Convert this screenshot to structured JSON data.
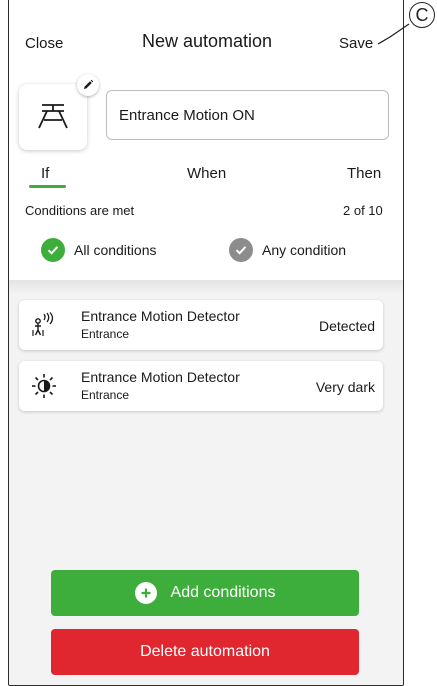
{
  "header": {
    "close_label": "Close",
    "title": "New automation",
    "save_label": "Save"
  },
  "callout": {
    "letter": "C"
  },
  "automation": {
    "icon": "motion-sensor-icon",
    "name": "Entrance Motion ON"
  },
  "tabs": [
    {
      "label": "If",
      "active": true
    },
    {
      "label": "When",
      "active": false
    },
    {
      "label": "Then",
      "active": false
    }
  ],
  "conditions": {
    "label": "Conditions are met",
    "count": "2 of 10",
    "options": [
      {
        "label": "All conditions",
        "selected": true,
        "color": "#3dae3b"
      },
      {
        "label": "Any condition",
        "selected": false,
        "color": "#8c8c8c"
      }
    ],
    "items": [
      {
        "icon": "motion-detector-icon",
        "title": "Entrance Motion Detector",
        "subtitle": "Entrance",
        "value": "Detected"
      },
      {
        "icon": "brightness-icon",
        "title": "Entrance Motion Detector",
        "subtitle": "Entrance",
        "value": "Very dark"
      }
    ]
  },
  "actions": {
    "add_label": "Add conditions",
    "delete_label": "Delete automation"
  },
  "colors": {
    "accent_green": "#3dae3b",
    "danger_red": "#e0262e",
    "list_background": "#f3f3f3"
  }
}
